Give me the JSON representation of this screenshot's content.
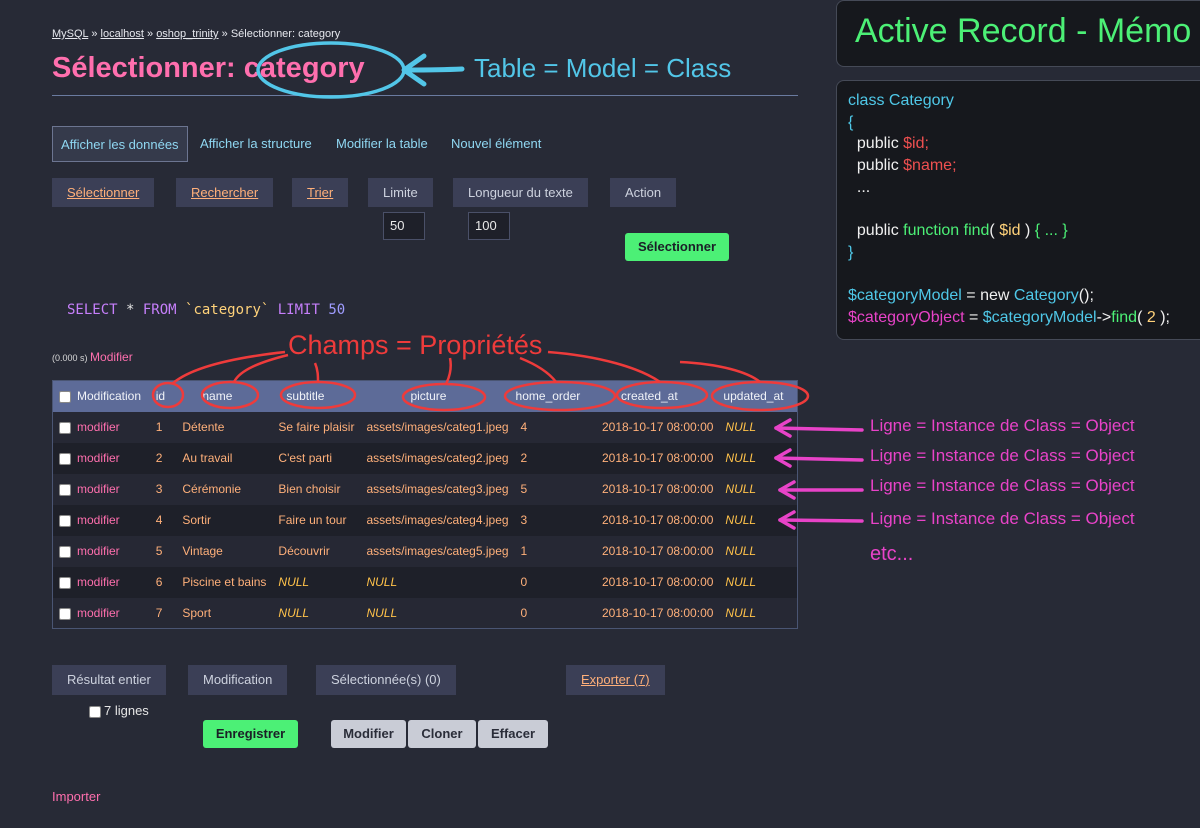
{
  "breadcrumb": {
    "mysql": "MySQL",
    "sep1": "»",
    "host": "localhost",
    "sep2": "»",
    "db": "oshop_trinity",
    "sep3": "»",
    "current": "Sélectionner: category"
  },
  "page_title": "Sélectionner: category",
  "tabs": [
    {
      "label": "Afficher les données",
      "active": true
    },
    {
      "label": "Afficher la structure"
    },
    {
      "label": "Modifier la table"
    },
    {
      "label": "Nouvel élément"
    }
  ],
  "actions": {
    "select": "Sélectionner",
    "search": "Rechercher",
    "sort": "Trier",
    "limit": "Limite",
    "text_length": "Longueur du texte",
    "action": "Action",
    "limit_value": "50",
    "text_length_value": "100",
    "submit": "Sélectionner"
  },
  "sql": {
    "select": "SELECT",
    "star": " * ",
    "from": "FROM",
    "table": " `category` ",
    "limit": "LIMIT",
    "limit_value": " 50"
  },
  "timing": {
    "value": "(0.000 s)",
    "edit_link": "Modifier"
  },
  "table": {
    "columns": [
      "Modification",
      "id",
      "name",
      "subtitle",
      "picture",
      "home_order",
      "created_at",
      "updated_at"
    ],
    "rows": [
      {
        "edit": "modifier",
        "id": "1",
        "name": "Détente",
        "subtitle": "Se faire plaisir",
        "picture": "assets/images/categ1.jpeg",
        "home_order": "4",
        "created_at": "2018-10-17 08:00:00",
        "updated_at": "NULL"
      },
      {
        "edit": "modifier",
        "id": "2",
        "name": "Au travail",
        "subtitle": "C'est parti",
        "picture": "assets/images/categ2.jpeg",
        "home_order": "2",
        "created_at": "2018-10-17 08:00:00",
        "updated_at": "NULL"
      },
      {
        "edit": "modifier",
        "id": "3",
        "name": "Cérémonie",
        "subtitle": "Bien choisir",
        "picture": "assets/images/categ3.jpeg",
        "home_order": "5",
        "created_at": "2018-10-17 08:00:00",
        "updated_at": "NULL"
      },
      {
        "edit": "modifier",
        "id": "4",
        "name": "Sortir",
        "subtitle": "Faire un tour",
        "picture": "assets/images/categ4.jpeg",
        "home_order": "3",
        "created_at": "2018-10-17 08:00:00",
        "updated_at": "NULL"
      },
      {
        "edit": "modifier",
        "id": "5",
        "name": "Vintage",
        "subtitle": "Découvrir",
        "picture": "assets/images/categ5.jpeg",
        "home_order": "1",
        "created_at": "2018-10-17 08:00:00",
        "updated_at": "NULL"
      },
      {
        "edit": "modifier",
        "id": "6",
        "name": "Piscine et bains",
        "subtitle": "NULL",
        "picture": "NULL",
        "home_order": "0",
        "created_at": "2018-10-17 08:00:00",
        "updated_at": "NULL"
      },
      {
        "edit": "modifier",
        "id": "7",
        "name": "Sport",
        "subtitle": "NULL",
        "picture": "NULL",
        "home_order": "0",
        "created_at": "2018-10-17 08:00:00",
        "updated_at": "NULL"
      }
    ]
  },
  "bottom": {
    "full_result": "Résultat entier",
    "modification": "Modification",
    "selected": "Sélectionnée(s) (0)",
    "export": "Exporter (7)",
    "lines": "7 lignes",
    "save": "Enregistrer",
    "edit": "Modifier",
    "clone": "Cloner",
    "delete": "Effacer",
    "import": "Importer"
  },
  "memo": {
    "title": "Active Record - Mémo",
    "code_lines": [
      "class Category",
      "{",
      "  public $id;",
      "  public $name;",
      "  ...",
      "",
      "  public function find( $id ) { ... }",
      "}",
      "",
      "$categoryModel = new Category();",
      "$categoryObject = $categoryModel->find( 2 );"
    ]
  },
  "annotations": {
    "table_model": "Table = Model = Class",
    "fields": "Champs = Propriétés",
    "row": "Ligne = Instance de Class = Object",
    "etc": "etc..."
  },
  "colors": {
    "background": "#272a36",
    "title_pink": "#ff6fae",
    "link_orange": "#ffb07a",
    "green_button": "#4cf076",
    "annotation_blue": "#52c6e8",
    "annotation_red": "#ee3b3b",
    "annotation_pink": "#e843c8"
  },
  "icons": {
    "arrow": "left-arrow-icon",
    "checkbox": "checkbox-icon"
  }
}
